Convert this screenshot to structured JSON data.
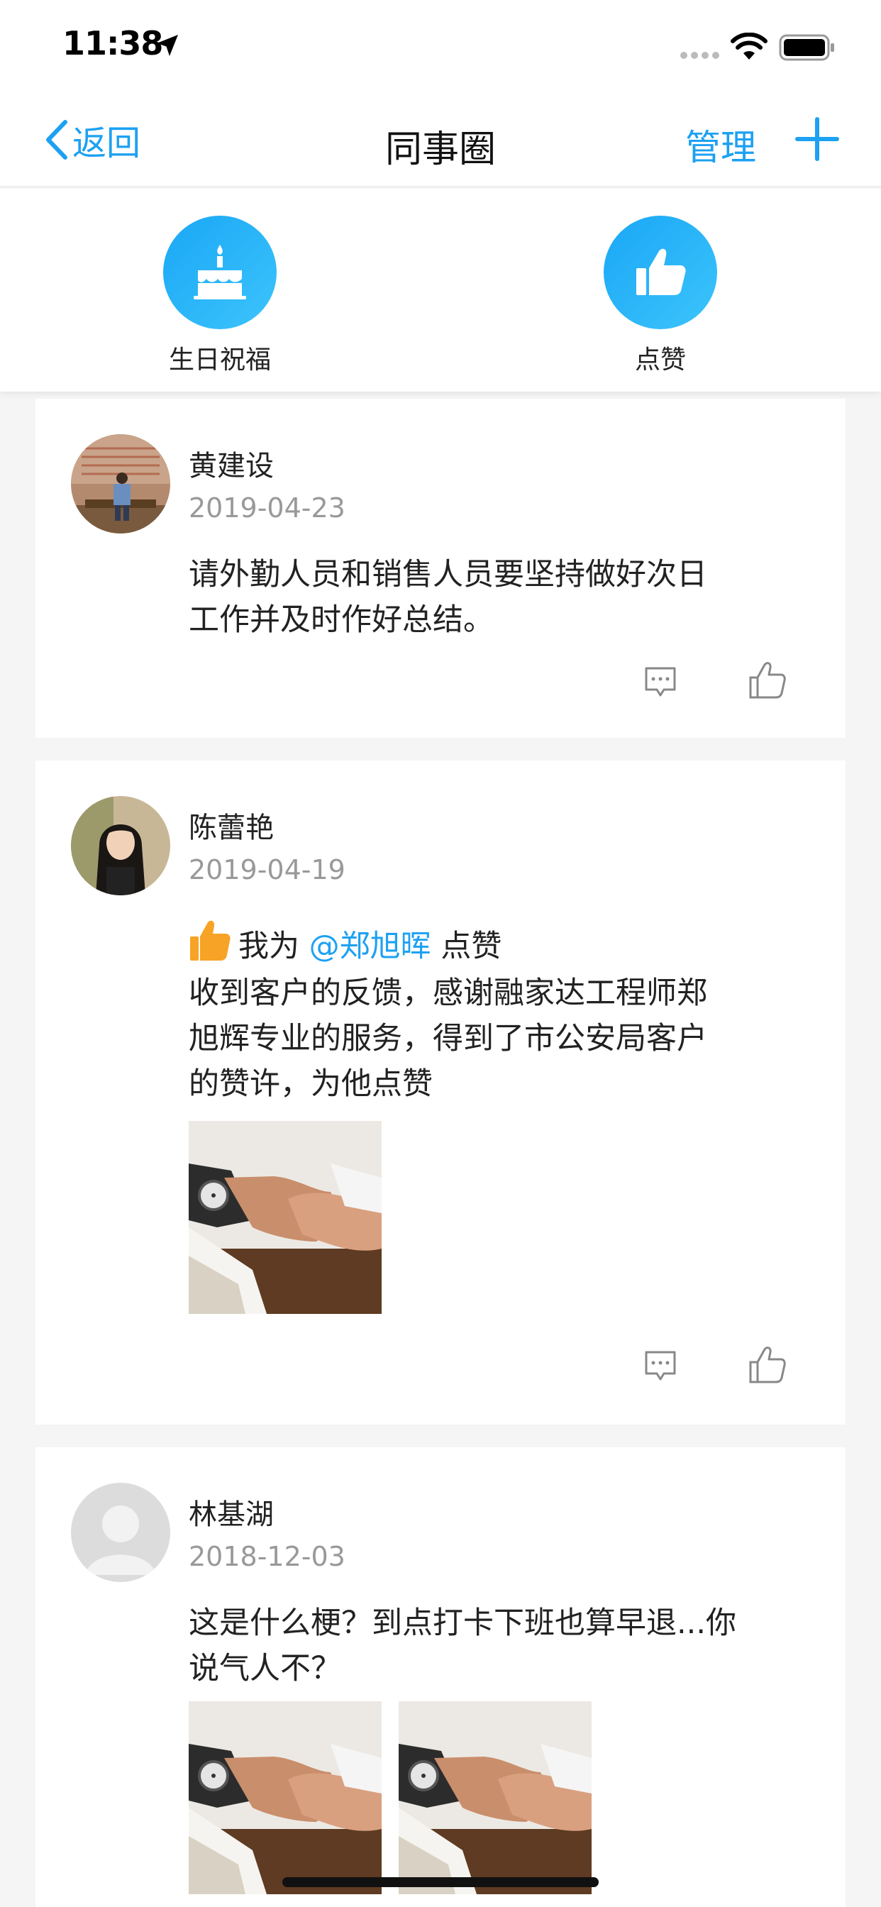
{
  "status_bar": {
    "time": "11:38"
  },
  "nav": {
    "back_label": "返回",
    "title": "同事圈",
    "manage_label": "管理"
  },
  "quick_actions": [
    {
      "label": "生日祝福",
      "icon": "birthday-cake-icon"
    },
    {
      "label": "点赞",
      "icon": "thumbs-up-icon"
    }
  ],
  "accent_color": "#1da1f2",
  "posts": [
    {
      "author": "黄建设",
      "date": "2019-04-23",
      "content_lines": [
        "请外勤人员和销售人员要坚持做好次日",
        "工作并及时作好总结。"
      ]
    },
    {
      "author": "陈蕾艳",
      "date": "2019-04-19",
      "like_prefix": "我为",
      "mention": "@郑旭晖",
      "like_suffix": "点赞",
      "content_lines": [
        "收到客户的反馈，感谢融家达工程师郑",
        "旭辉专业的服务，得到了市公安局客户",
        "的赞许，为他点赞"
      ]
    },
    {
      "author": "林基湖",
      "date": "2018-12-03",
      "content_lines": [
        "这是什么梗？到点打卡下班也算早退...你",
        "说气人不？"
      ]
    }
  ]
}
